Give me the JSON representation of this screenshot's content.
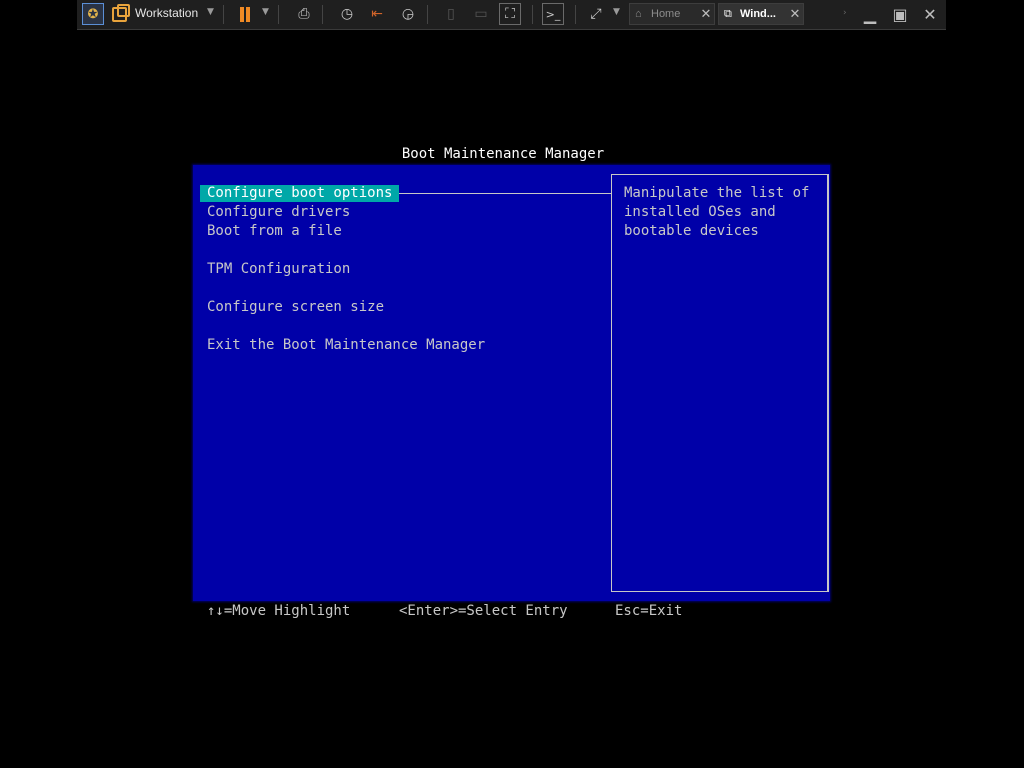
{
  "toolbar": {
    "app_name": "Workstation",
    "tabs": [
      {
        "label": "Home"
      },
      {
        "label": "Wind..."
      }
    ]
  },
  "bios": {
    "title": "Boot Maintenance Manager",
    "menu": [
      {
        "label": "Configure boot options",
        "selected": true
      },
      {
        "label": "Configure drivers"
      },
      {
        "label": "Boot from a file"
      },
      {
        "label": "TPM Configuration"
      },
      {
        "label": "Configure screen size"
      },
      {
        "label": "Exit the Boot Maintenance Manager"
      }
    ],
    "help": [
      "Manipulate the list of",
      "installed OSes and",
      "bootable devices"
    ],
    "footer": [
      "↑↓=Move Highlight",
      "<Enter>=Select Entry",
      "Esc=Exit"
    ],
    "colors": {
      "background": "#0000a8",
      "highlight": "#00a8a8",
      "text": "#c8c8c8",
      "title": "#ffffff"
    }
  }
}
